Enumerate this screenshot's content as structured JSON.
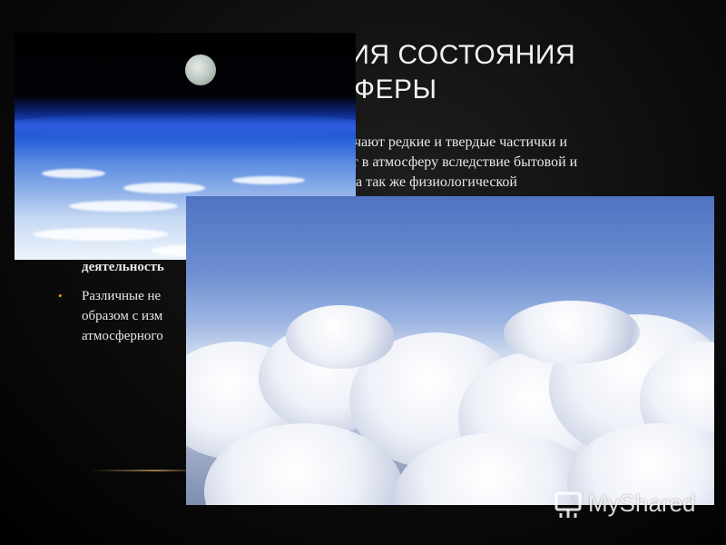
{
  "slide": {
    "title_lines": [
      "ЕНЕНИЯ СОСТОЯНИЯ",
      "СФЕРЫ"
    ],
    "body_lines": [
      "чают редкие и твердые частички и",
      "от в атмосферу вследствие бытовой и",
      "а так же физиологической"
    ],
    "left_bold": "деятельность",
    "bullet_lines": [
      "Различные не",
      "образом с изм",
      "атмосферного"
    ]
  },
  "watermark": {
    "text": "MyShared"
  },
  "colors": {
    "background": "#000000",
    "bullet": "#f0a000",
    "text": "#ffffff"
  }
}
